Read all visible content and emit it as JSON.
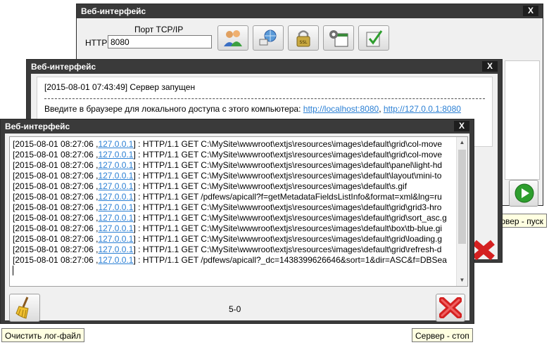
{
  "window1": {
    "title": "Веб-интерфейс",
    "close_label": "X",
    "port_label": "Порт TCP/IP",
    "protocol_label": "HTTP",
    "port_value": "8080",
    "start_tooltip": "Сервер - пуск",
    "toolbar_icons": [
      "users-icon",
      "globe-computer-icon",
      "ssl-lock-icon",
      "gear-window-icon",
      "checklist-icon"
    ]
  },
  "window2": {
    "title": "Веб-интерфейс",
    "close_label": "X",
    "server_started": "[2015-08-01 07:43:49] Сервер запущен",
    "local_access_prefix": "Введите в браузере для локального доступа с этого компьютера: ",
    "local_link1": "http://localhost:8080",
    "separator": ", ",
    "local_link2": "http://127.0.0.1:8080"
  },
  "window3": {
    "title": "Веб-интерфейс",
    "close_label": "X",
    "log_lines": [
      {
        "ts": "[2015-08-01 08:27:06 ,",
        "ip": "127.0.0.1",
        "rest": "] : HTTP/1.1 GET C:\\MySite\\wwwroot\\extjs\\resources\\images\\default\\grid\\col-move"
      },
      {
        "ts": "[2015-08-01 08:27:06 ,",
        "ip": "127.0.0.1",
        "rest": "] : HTTP/1.1 GET C:\\MySite\\wwwroot\\extjs\\resources\\images\\default\\grid\\col-move"
      },
      {
        "ts": "[2015-08-01 08:27:06 ,",
        "ip": "127.0.0.1",
        "rest": "] : HTTP/1.1 GET C:\\MySite\\wwwroot\\extjs\\resources\\images\\default\\panel\\light-hd"
      },
      {
        "ts": "[2015-08-01 08:27:06 ,",
        "ip": "127.0.0.1",
        "rest": "] : HTTP/1.1 GET C:\\MySite\\wwwroot\\extjs\\resources\\images\\default\\layout\\mini-to"
      },
      {
        "ts": "[2015-08-01 08:27:06 ,",
        "ip": "127.0.0.1",
        "rest": "] : HTTP/1.1 GET C:\\MySite\\wwwroot\\extjs\\resources\\images\\default\\s.gif"
      },
      {
        "ts": "[2015-08-01 08:27:06 ,",
        "ip": "127.0.0.1",
        "rest": "] : HTTP/1.1 GET /pdfews/apicall?f=getMetadataFieldsListInfo&format=xml&lng=ru"
      },
      {
        "ts": "[2015-08-01 08:27:06 ,",
        "ip": "127.0.0.1",
        "rest": "] : HTTP/1.1 GET C:\\MySite\\wwwroot\\extjs\\resources\\images\\default\\grid\\grid3-hro"
      },
      {
        "ts": "[2015-08-01 08:27:06 ,",
        "ip": "127.0.0.1",
        "rest": "] : HTTP/1.1 GET C:\\MySite\\wwwroot\\extjs\\resources\\images\\default\\grid\\sort_asc.g"
      },
      {
        "ts": "[2015-08-01 08:27:06 ,",
        "ip": "127.0.0.1",
        "rest": "] : HTTP/1.1 GET C:\\MySite\\wwwroot\\extjs\\resources\\images\\default\\box\\tb-blue.gi"
      },
      {
        "ts": "[2015-08-01 08:27:06 ,",
        "ip": "127.0.0.1",
        "rest": "] : HTTP/1.1 GET C:\\MySite\\wwwroot\\extjs\\resources\\images\\default\\grid\\loading.g"
      },
      {
        "ts": "[2015-08-01 08:27:06 ,",
        "ip": "127.0.0.1",
        "rest": "] : HTTP/1.1 GET C:\\MySite\\wwwroot\\extjs\\resources\\images\\default\\grid\\refresh-d"
      },
      {
        "ts": "[2015-08-01 08:27:06 ,",
        "ip": "127.0.0.1",
        "rest": "] : HTTP/1.1 GET /pdfews/apicall?_dc=1438399626646&sort=1&dir=ASC&f=DBSea"
      }
    ],
    "counter": "5-0",
    "clear_tooltip": "Очистить лог-файл",
    "stop_tooltip": "Сервер - стоп"
  },
  "colors": {
    "titlebar": "#3a3a3a",
    "link": "#2a7fd4",
    "stop_red": "#d42020",
    "start_green": "#2e9e2e"
  }
}
